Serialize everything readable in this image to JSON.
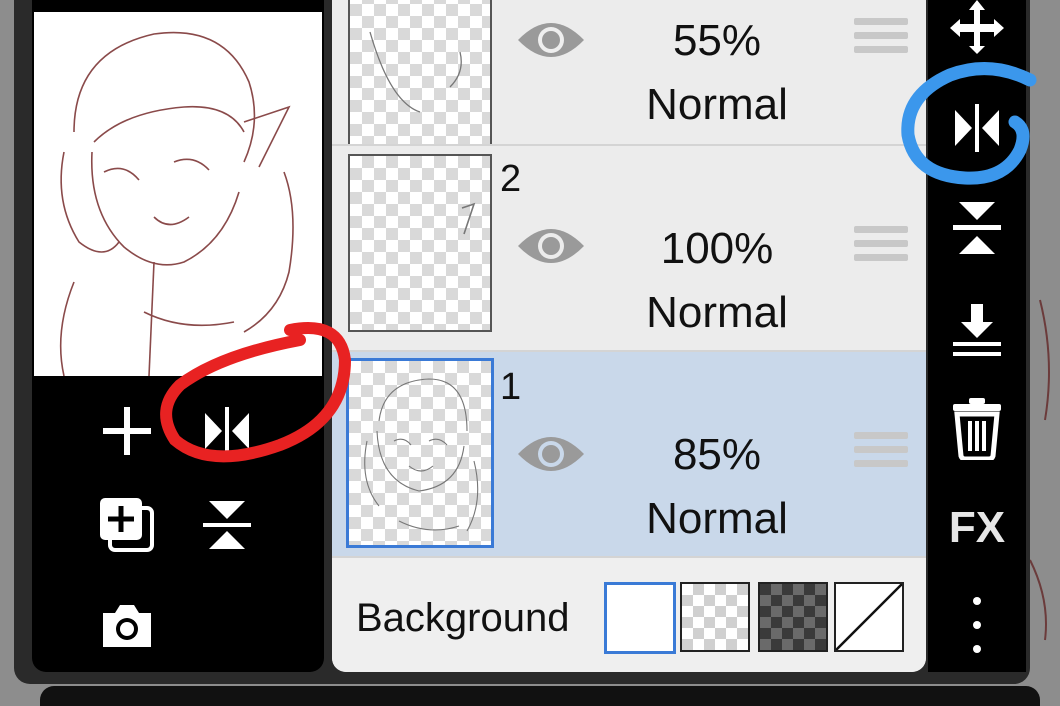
{
  "left_tools": {
    "add_layer": "plus-icon",
    "flip_horizontal": "flip-horizontal-icon",
    "duplicate_layer": "duplicate-layer-icon",
    "flip_vertical": "flip-vertical-icon",
    "camera": "camera-icon"
  },
  "layers": [
    {
      "number": "",
      "opacity": "55%",
      "blend": "Normal",
      "selected": false
    },
    {
      "number": "2",
      "opacity": "100%",
      "blend": "Normal",
      "selected": false
    },
    {
      "number": "1",
      "opacity": "85%",
      "blend": "Normal",
      "selected": true
    }
  ],
  "background": {
    "label": "Background",
    "swatches": [
      "white",
      "transparent",
      "dark-checker",
      "diagonal-none"
    ],
    "selected": "white"
  },
  "right_tools": {
    "move": "move-arrows-icon",
    "flip_horizontal": "flip-horizontal-icon",
    "flip_vertical": "flip-vertical-icon",
    "merge_down": "merge-down-icon",
    "delete": "trash-icon",
    "fx_label": "FX",
    "more": "more-vertical-icon"
  },
  "colors": {
    "selection_blue": "#3a7ad6",
    "selected_row": "#c9d8ea",
    "annotation_red": "#e82222",
    "annotation_blue": "#3b97ec"
  }
}
